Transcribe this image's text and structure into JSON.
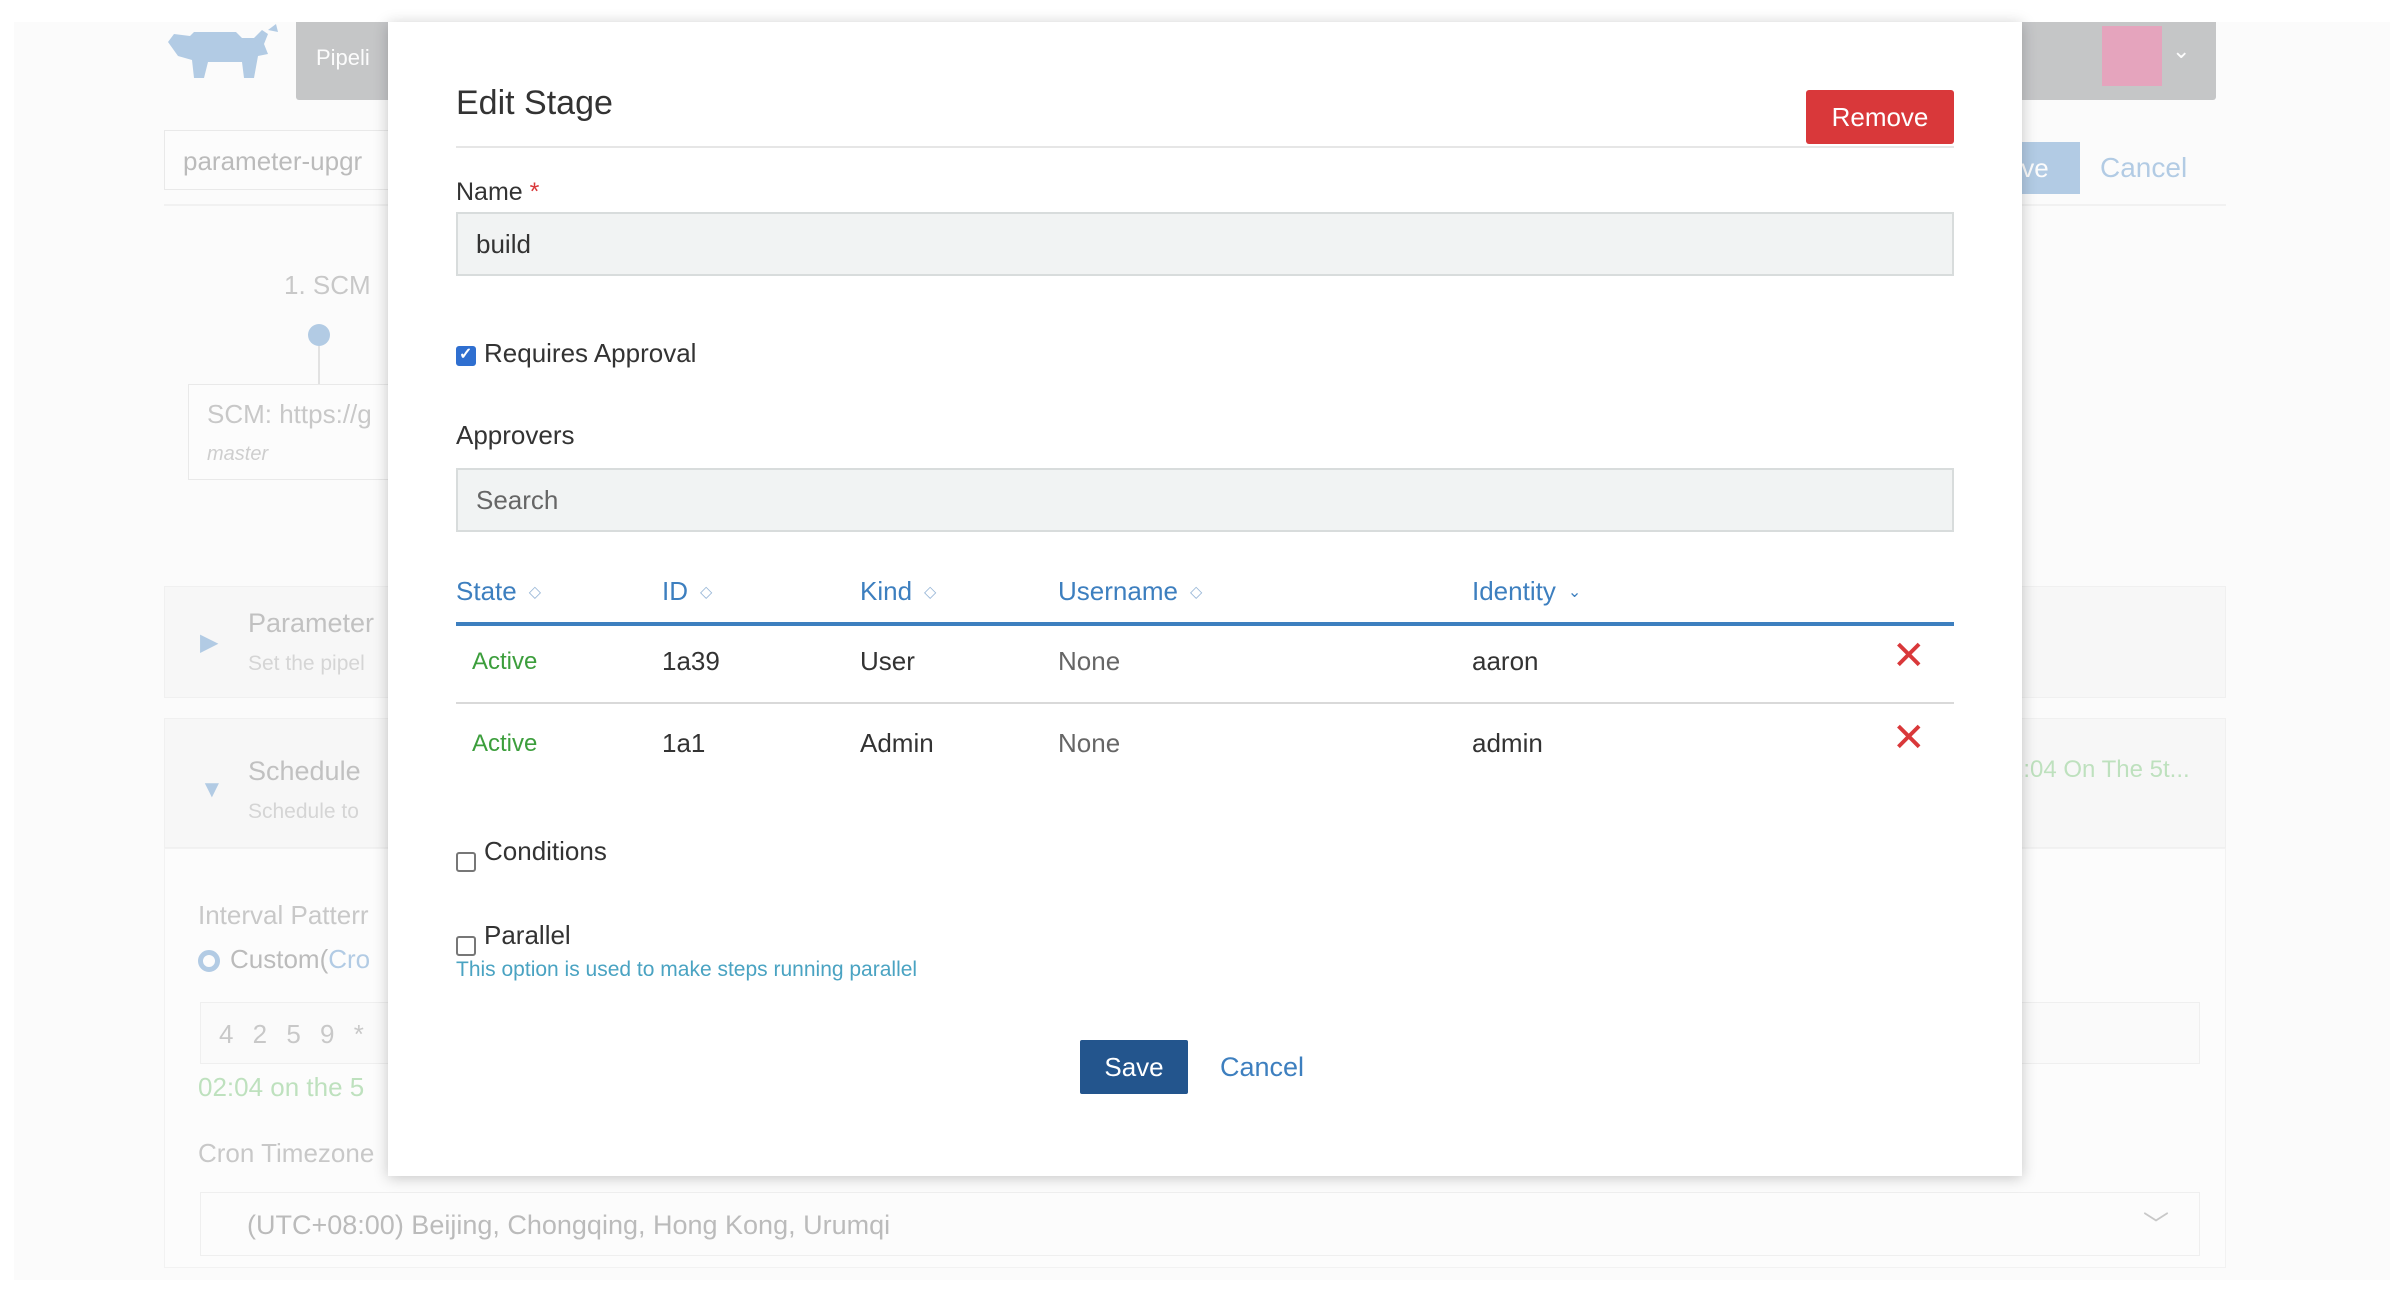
{
  "background": {
    "nav_tab": "Pipeli",
    "pipeline_name": "parameter-upgr",
    "save_label": "ve",
    "cancel_label": "Cancel",
    "stage_label": "1. SCM",
    "scm_text": "SCM: https://g",
    "scm_branch": "master",
    "panels": {
      "parameters": {
        "title": "Parameter",
        "subtitle": "Set the pipel"
      },
      "schedule": {
        "title": "Schedule",
        "subtitle": "Schedule to",
        "summary": "2:04 On The 5t..."
      }
    },
    "interval_label": "Interval Patterr",
    "custom_label_a": "Custom(",
    "custom_label_b": "Cro",
    "cron_value": "4 2 5 9 *",
    "cron_desc": "02:04 on the 5",
    "timezone_label": "Cron Timezone",
    "timezone_value": "(UTC+08:00) Beijing, Chongqing, Hong Kong, Urumqi"
  },
  "modal": {
    "title": "Edit Stage",
    "remove_label": "Remove",
    "name_label": "Name",
    "name_required": "*",
    "name_value": "build",
    "requires_approval": {
      "label": "Requires Approval",
      "checked": true
    },
    "approvers_label": "Approvers",
    "search_placeholder": "Search",
    "columns": [
      "State",
      "ID",
      "Kind",
      "Username",
      "Identity"
    ],
    "sort_glyph": "◇",
    "rows": [
      {
        "state": "Active",
        "id": "1a39",
        "kind": "User",
        "username": "None",
        "identity": "aaron"
      },
      {
        "state": "Active",
        "id": "1a1",
        "kind": "Admin",
        "username": "None",
        "identity": "admin"
      }
    ],
    "delete_glyph": "✕",
    "conditions": {
      "label": "Conditions",
      "checked": false
    },
    "parallel": {
      "label": "Parallel",
      "checked": false,
      "help": "This option is used to make steps running parallel"
    },
    "save_label": "Save",
    "cancel_label": "Cancel"
  },
  "colors": {
    "primary": "#3d7fbf",
    "danger": "#d9383a",
    "save": "#23558d",
    "active": "#3c9e3c"
  }
}
